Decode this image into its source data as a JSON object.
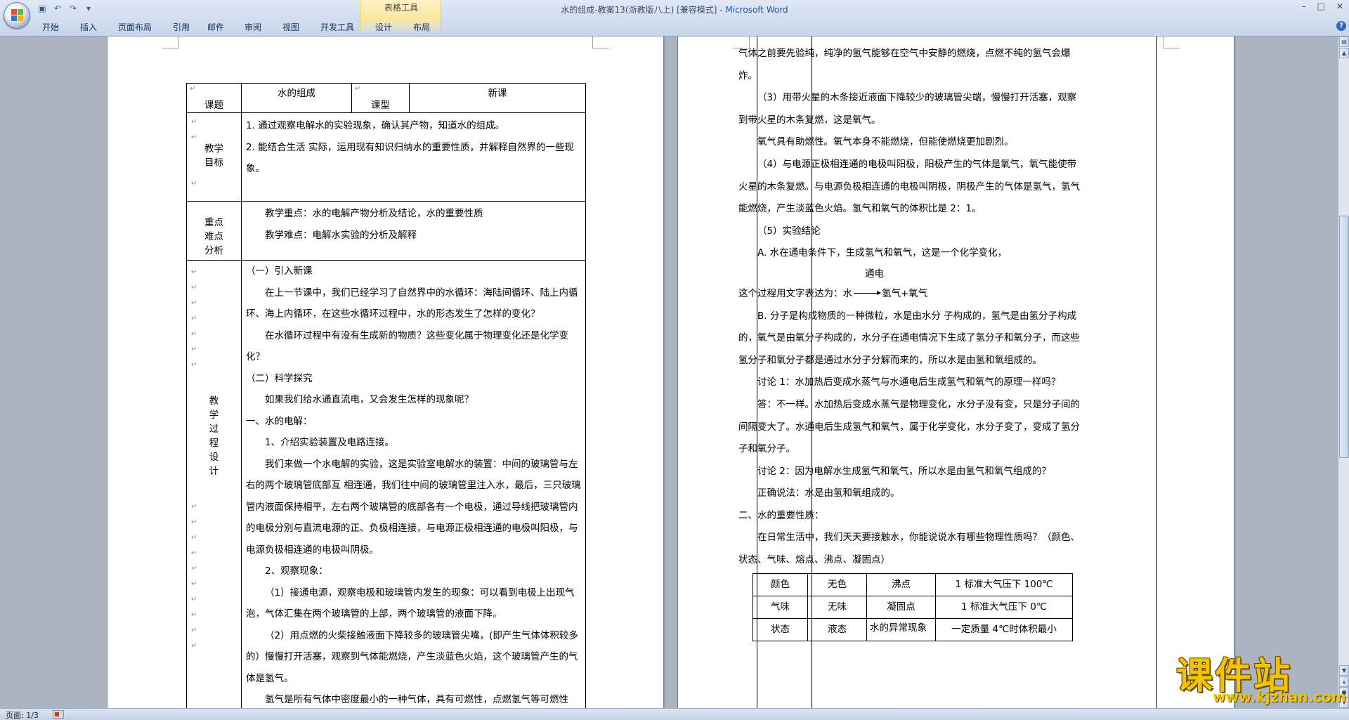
{
  "window": {
    "title": "水的组成-教案13(浙教版八上) [兼容模式] - ",
    "app_name": "Microsoft Word",
    "minimize_icon": "minimize-icon",
    "maximize_icon": "maximize-icon",
    "close_icon": "close-icon"
  },
  "ribbon": {
    "contextual_group": "表格工具",
    "tabs": [
      "开始",
      "插入",
      "页面布局",
      "引用",
      "邮件",
      "审阅",
      "视图",
      "开发工具",
      "设计",
      "布局"
    ]
  },
  "status": {
    "page": "页面: 1/3"
  },
  "left_page": {
    "header": {
      "label1": "课题",
      "value1": "水的组成",
      "label2": "课型",
      "value2": "新课"
    },
    "goal": {
      "label": [
        "教学",
        "目标"
      ],
      "lines": [
        "1. 通过观察电解水的实验现象，确认其产物，知道水的组成。",
        "2. 能结合生活 实际，运用现有知识归纳水的重要性质，并解释自然界的一些现象。"
      ]
    },
    "key": {
      "label": [
        "重点",
        "难点",
        "分析"
      ],
      "lines": [
        "教学重点：水的电解产物分析及结论，水的重要性质",
        "教学难点：电解水实验的分析及解释"
      ]
    },
    "process": {
      "label": [
        "教",
        "学",
        "过",
        "程",
        "设",
        "计"
      ],
      "paragraphs": [
        "（一）引入新课",
        "在上一节课中，我们已经学习了自然界中的水循环：海陆间循环、陆上内循环、海上内循环，在这些水循环过程中，水的形态发生了怎样的变化？",
        "在水循环过程中有没有生成新的物质？这些变化属于物理变化还是化学变化？",
        "（二）科学探究",
        "如果我们给水通直流电，又会发生怎样的现象呢？",
        "一、水的电解：",
        "1、介绍实验装置及电路连接。",
        "我们来做一个水电解的实验，这是实验室电解水的装置：中间的玻璃管与左右的两个玻璃管底部互 相连通，我们往中间的玻璃管里注入水，最后，三只玻璃管内液面保持相平，左右两个玻璃管的底部各有一个电极，通过导线把玻璃管内的电极分别与直流电源的正、负极相连接，与电源正极相连通的电极叫阳极，与电源负极相连通的电极叫阴极。",
        "2、观察现象：",
        "（1）接通电源，观察电极和玻璃管内发生的现象：可以看到电极上出现气泡，气体汇集在两个玻璃管的上部，两个玻璃管的液面下降。",
        "（2）用点燃的火柴接触液面下降较多的玻璃管尖嘴，(即产生气体体积较多的）慢慢打开活塞，观察到气体能燃烧，产生淡蓝色火焰，这个玻璃管产生的气体是氢气。",
        "氢气是所有气体中密度最小的一种气体，具有可燃性，点燃氢气等可燃性"
      ]
    }
  },
  "right_page": {
    "paragraphs": [
      "气体之前要先验纯，纯净的氢气能够在空气中安静的燃烧，点燃不纯的氢气会爆炸。",
      "（3）用带火星的木条接近液面下降较少的玻璃管尖端，慢慢打开活塞，观察到带火星的木条复燃，这是氧气。",
      "氧气具有助燃性。氧气本身不能燃烧，但能使燃烧更加剧烈。",
      "（4）与电源正极相连通的电极叫阳极，阳极产生的气体是氧气，氧气能使带火星的木条复燃。与电源负极相连通的电极叫阴极，阴极产生的气体是氢气，氢气能燃烧，产生淡蓝色火焰。氢气和氧气的体积比是 2：1。",
      "（5）实验结论",
      "A. 水在通电条件下，生成氢气和氧气，这是一个化学变化，"
    ],
    "equation": {
      "condition": "通电",
      "prefix": "这个过程用文字表达为：水",
      "products": "氢气+氧气"
    },
    "paragraphs2": [
      "B. 分子是构成物质的一种微粒，水是由水分 子构成的，氢气是由氢分子构成的，氧气是由氧分子构成的，水分子在通电情况下生成了氢分子和氧分子，而这些氢分子和氧分子都是通过水分子分解而来的，所以水是由氢和氧组成的。",
      "讨论 1：水加热后变成水蒸气与水通电后生成氢气和氧气的原理一样吗？",
      "答：不一样。水加热后变成水蒸气是物理变化，水分子没有变，只是分子间的间隔变大了。水通电后生成氢气和氧气，属于化学变化，水分子变了，变成了氢分子和氧分子。",
      "讨论 2：因为电解水生成氢气和氧气，所以水是由氢气和氧气组成的？",
      "正确说法：水是由氢和氧组成的。",
      "二、水的重要性质：",
      "在日常生活中，我们天天要接触水，你能说说水有哪些物理性质吗？（颜色、状态、气味、熔点、沸点、凝固点）"
    ],
    "property_table": [
      [
        "颜色",
        "无色",
        "沸点",
        "1 标准大气压下 100℃"
      ],
      [
        "气味",
        "无味",
        "凝固点",
        "1 标准大气压下 0℃"
      ],
      [
        "状态",
        "液态",
        "水的异常现象",
        "一定质量 4℃时体积最小"
      ]
    ]
  },
  "watermark": {
    "title": "课件站",
    "url": "www.kjzhan.com"
  }
}
